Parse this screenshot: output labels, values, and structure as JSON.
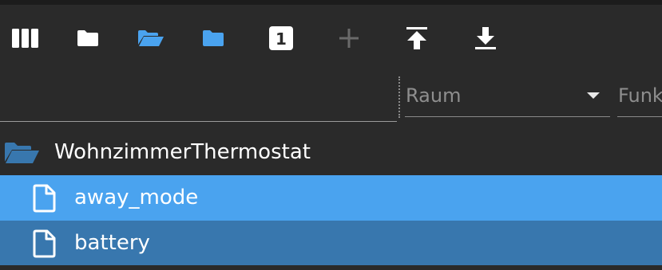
{
  "toolbar": {
    "buttons": [
      {
        "icon": "columns-icon",
        "color": "#ffffff"
      },
      {
        "icon": "folder-icon",
        "color": "#ffffff"
      },
      {
        "icon": "folder-open-icon",
        "color": "#4aa3ef"
      },
      {
        "icon": "folder-icon",
        "color": "#4aa3ef"
      },
      {
        "icon": "number-badge-icon",
        "text": "1",
        "color": "#ffffff"
      },
      {
        "icon": "add-icon",
        "color": "#6a6a6a"
      },
      {
        "icon": "upload-icon",
        "color": "#ffffff"
      },
      {
        "icon": "download-icon",
        "color": "#ffffff"
      }
    ]
  },
  "filters": {
    "name_value": "",
    "room_label": "Raum",
    "function_label": "Funk"
  },
  "tree": {
    "folder": {
      "label": "WohnzimmerThermostat",
      "icon": "folder-open-icon"
    },
    "items": [
      {
        "label": "away_mode",
        "icon": "file-icon",
        "state": "selected"
      },
      {
        "label": "battery",
        "icon": "file-icon",
        "state": "hover"
      }
    ]
  },
  "colors": {
    "background": "#2a2a2a",
    "selected": "#4aa3ef",
    "hover": "#3877ae",
    "accent": "#4aa3ef"
  }
}
